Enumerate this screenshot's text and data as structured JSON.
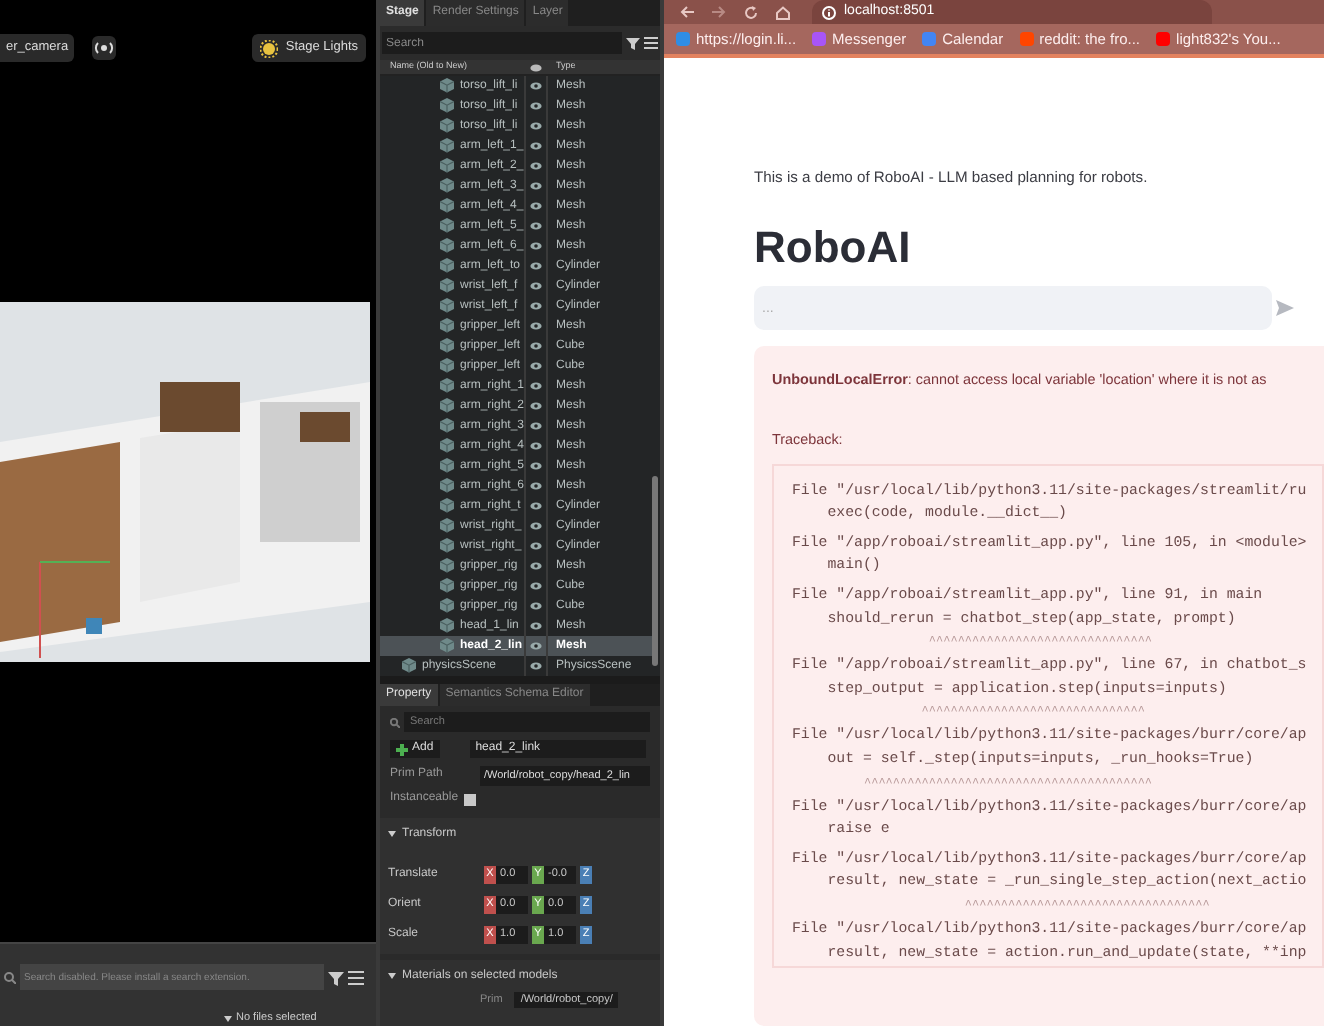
{
  "viewport": {
    "camera_label": "er_camera",
    "lights_label": "Stage Lights",
    "search_placeholder": "Search disabled. Please install a search extension.",
    "files_label": "No files selected"
  },
  "stage": {
    "tabs": [
      {
        "label": "Stage",
        "selected": true
      },
      {
        "label": "Render Settings",
        "selected": false
      },
      {
        "label": "Layer",
        "selected": false
      }
    ],
    "search_placeholder": "Search",
    "columns": [
      "Name (Old to New)",
      "Type"
    ],
    "rows": [
      {
        "name": "torso_lift_li",
        "type": "Mesh",
        "selected": false
      },
      {
        "name": "torso_lift_li",
        "type": "Mesh",
        "selected": false
      },
      {
        "name": "torso_lift_li",
        "type": "Mesh",
        "selected": false
      },
      {
        "name": "arm_left_1_",
        "type": "Mesh",
        "selected": false
      },
      {
        "name": "arm_left_2_",
        "type": "Mesh",
        "selected": false
      },
      {
        "name": "arm_left_3_",
        "type": "Mesh",
        "selected": false
      },
      {
        "name": "arm_left_4_",
        "type": "Mesh",
        "selected": false
      },
      {
        "name": "arm_left_5_",
        "type": "Mesh",
        "selected": false
      },
      {
        "name": "arm_left_6_",
        "type": "Mesh",
        "selected": false
      },
      {
        "name": "arm_left_to",
        "type": "Cylinder",
        "selected": false
      },
      {
        "name": "wrist_left_f",
        "type": "Cylinder",
        "selected": false
      },
      {
        "name": "wrist_left_f",
        "type": "Cylinder",
        "selected": false
      },
      {
        "name": "gripper_left",
        "type": "Mesh",
        "selected": false
      },
      {
        "name": "gripper_left",
        "type": "Cube",
        "selected": false
      },
      {
        "name": "gripper_left",
        "type": "Cube",
        "selected": false
      },
      {
        "name": "arm_right_1",
        "type": "Mesh",
        "selected": false
      },
      {
        "name": "arm_right_2",
        "type": "Mesh",
        "selected": false
      },
      {
        "name": "arm_right_3",
        "type": "Mesh",
        "selected": false
      },
      {
        "name": "arm_right_4",
        "type": "Mesh",
        "selected": false
      },
      {
        "name": "arm_right_5",
        "type": "Mesh",
        "selected": false
      },
      {
        "name": "arm_right_6",
        "type": "Mesh",
        "selected": false
      },
      {
        "name": "arm_right_t",
        "type": "Cylinder",
        "selected": false
      },
      {
        "name": "wrist_right_",
        "type": "Cylinder",
        "selected": false
      },
      {
        "name": "wrist_right_",
        "type": "Cylinder",
        "selected": false
      },
      {
        "name": "gripper_rig",
        "type": "Mesh",
        "selected": false
      },
      {
        "name": "gripper_rig",
        "type": "Cube",
        "selected": false
      },
      {
        "name": "gripper_rig",
        "type": "Cube",
        "selected": false
      },
      {
        "name": "head_1_lin",
        "type": "Mesh",
        "selected": false
      },
      {
        "name": "head_2_lin",
        "type": "Mesh",
        "selected": true
      }
    ],
    "scene_row": {
      "name": "physicsScene",
      "type": "PhysicsScene"
    }
  },
  "property": {
    "tabs": [
      {
        "label": "Property",
        "selected": true
      },
      {
        "label": "Semantics Schema Editor",
        "selected": false
      }
    ],
    "search_placeholder": "Search",
    "add_label": "Add",
    "name_value": "head_2_link",
    "prim_path_label": "Prim Path",
    "prim_path_value": "/World/robot_copy/head_2_lin",
    "instanceable_label": "Instanceable",
    "instanceable": false,
    "transform_label": "Transform",
    "transform_expanded": true,
    "transforms": [
      {
        "label": "Translate",
        "axes": [
          {
            "label": "X",
            "value": "0.0"
          },
          {
            "label": "Y",
            "value": "-0.0"
          },
          {
            "label": "Z"
          }
        ]
      },
      {
        "label": "Orient",
        "axes": [
          {
            "label": "X",
            "value": "0.0"
          },
          {
            "label": "Y",
            "value": "0.0"
          },
          {
            "label": "Z"
          }
        ]
      },
      {
        "label": "Scale",
        "axes": [
          {
            "label": "X",
            "value": "1.0"
          },
          {
            "label": "Y",
            "value": "1.0"
          },
          {
            "label": "Z"
          }
        ]
      }
    ],
    "materials_label": "Materials on selected models",
    "materials_expanded": true,
    "prim_label": "Prim",
    "prim_value": "/World/robot_copy/"
  },
  "browser": {
    "url": "localhost:8501",
    "bookmarks": [
      {
        "label": "https://login.li...",
        "color": "#2f8de4"
      },
      {
        "label": "Messenger",
        "color": "#a855f7"
      },
      {
        "label": "Calendar",
        "color": "#4285f4"
      },
      {
        "label": "reddit: the fro...",
        "color": "#ff4500"
      },
      {
        "label": "light832's You...",
        "color": "#ff0000"
      }
    ],
    "intro": "This is a demo of RoboAI - LLM based planning for robots.",
    "title": "RoboAI",
    "chat_placeholder": "...",
    "error": "**UnboundLocalError**: cannot access local variable 'location' where it is not as",
    "traceback_label": "Traceback:",
    "frames": [
      {
        "file": "File \"/usr/local/lib/python3.11/site-packages/streamlit/ru",
        "code": "    exec(code, module.__dict__)"
      },
      {
        "file": "File \"/app/roboai/streamlit_app.py\", line 105, in <module>",
        "code": "    main()"
      },
      {
        "file": "File \"/app/roboai/streamlit_app.py\", line 91, in main",
        "code": "    should_rerun = chatbot_step(app_state, prompt)",
        "caret": "                   ^^^^^^^^^^^^^^^^^^^^^^^^^^^^^^^"
      },
      {
        "file": "File \"/app/roboai/streamlit_app.py\", line 67, in chatbot_s",
        "code": "    step_output = application.step(inputs=inputs)",
        "caret": "                  ^^^^^^^^^^^^^^^^^^^^^^^^^^^^^^^"
      },
      {
        "file": "File \"/usr/local/lib/python3.11/site-packages/burr/core/ap",
        "code": "    out = self._step(inputs=inputs, _run_hooks=True)",
        "caret": "          ^^^^^^^^^^^^^^^^^^^^^^^^^^^^^^^^^^^^^^^^"
      },
      {
        "file": "File \"/usr/local/lib/python3.11/site-packages/burr/core/ap",
        "code": "    raise e"
      },
      {
        "file": "File \"/usr/local/lib/python3.11/site-packages/burr/core/ap",
        "code": "    result, new_state = _run_single_step_action(next_actio",
        "caret": "                        ^^^^^^^^^^^^^^^^^^^^^^^^^^^^^^^^^^"
      },
      {
        "file": "File \"/usr/local/lib/python3.11/site-packages/burr/core/ap",
        "code": "    result, new_state = action.run_and_update(state, **inp"
      }
    ]
  }
}
